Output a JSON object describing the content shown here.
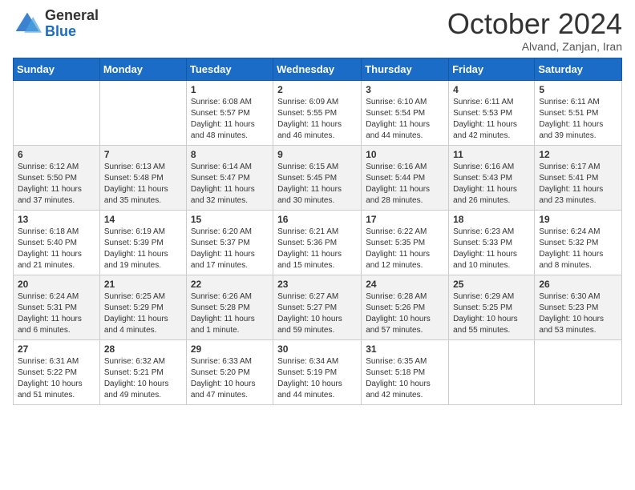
{
  "logo": {
    "general": "General",
    "blue": "Blue"
  },
  "header": {
    "month": "October 2024",
    "location": "Alvand, Zanjan, Iran"
  },
  "days_of_week": [
    "Sunday",
    "Monday",
    "Tuesday",
    "Wednesday",
    "Thursday",
    "Friday",
    "Saturday"
  ],
  "weeks": [
    [
      {
        "day": "",
        "sunrise": "",
        "sunset": "",
        "daylight": ""
      },
      {
        "day": "",
        "sunrise": "",
        "sunset": "",
        "daylight": ""
      },
      {
        "day": "1",
        "sunrise": "Sunrise: 6:08 AM",
        "sunset": "Sunset: 5:57 PM",
        "daylight": "Daylight: 11 hours and 48 minutes."
      },
      {
        "day": "2",
        "sunrise": "Sunrise: 6:09 AM",
        "sunset": "Sunset: 5:55 PM",
        "daylight": "Daylight: 11 hours and 46 minutes."
      },
      {
        "day": "3",
        "sunrise": "Sunrise: 6:10 AM",
        "sunset": "Sunset: 5:54 PM",
        "daylight": "Daylight: 11 hours and 44 minutes."
      },
      {
        "day": "4",
        "sunrise": "Sunrise: 6:11 AM",
        "sunset": "Sunset: 5:53 PM",
        "daylight": "Daylight: 11 hours and 42 minutes."
      },
      {
        "day": "5",
        "sunrise": "Sunrise: 6:11 AM",
        "sunset": "Sunset: 5:51 PM",
        "daylight": "Daylight: 11 hours and 39 minutes."
      }
    ],
    [
      {
        "day": "6",
        "sunrise": "Sunrise: 6:12 AM",
        "sunset": "Sunset: 5:50 PM",
        "daylight": "Daylight: 11 hours and 37 minutes."
      },
      {
        "day": "7",
        "sunrise": "Sunrise: 6:13 AM",
        "sunset": "Sunset: 5:48 PM",
        "daylight": "Daylight: 11 hours and 35 minutes."
      },
      {
        "day": "8",
        "sunrise": "Sunrise: 6:14 AM",
        "sunset": "Sunset: 5:47 PM",
        "daylight": "Daylight: 11 hours and 32 minutes."
      },
      {
        "day": "9",
        "sunrise": "Sunrise: 6:15 AM",
        "sunset": "Sunset: 5:45 PM",
        "daylight": "Daylight: 11 hours and 30 minutes."
      },
      {
        "day": "10",
        "sunrise": "Sunrise: 6:16 AM",
        "sunset": "Sunset: 5:44 PM",
        "daylight": "Daylight: 11 hours and 28 minutes."
      },
      {
        "day": "11",
        "sunrise": "Sunrise: 6:16 AM",
        "sunset": "Sunset: 5:43 PM",
        "daylight": "Daylight: 11 hours and 26 minutes."
      },
      {
        "day": "12",
        "sunrise": "Sunrise: 6:17 AM",
        "sunset": "Sunset: 5:41 PM",
        "daylight": "Daylight: 11 hours and 23 minutes."
      }
    ],
    [
      {
        "day": "13",
        "sunrise": "Sunrise: 6:18 AM",
        "sunset": "Sunset: 5:40 PM",
        "daylight": "Daylight: 11 hours and 21 minutes."
      },
      {
        "day": "14",
        "sunrise": "Sunrise: 6:19 AM",
        "sunset": "Sunset: 5:39 PM",
        "daylight": "Daylight: 11 hours and 19 minutes."
      },
      {
        "day": "15",
        "sunrise": "Sunrise: 6:20 AM",
        "sunset": "Sunset: 5:37 PM",
        "daylight": "Daylight: 11 hours and 17 minutes."
      },
      {
        "day": "16",
        "sunrise": "Sunrise: 6:21 AM",
        "sunset": "Sunset: 5:36 PM",
        "daylight": "Daylight: 11 hours and 15 minutes."
      },
      {
        "day": "17",
        "sunrise": "Sunrise: 6:22 AM",
        "sunset": "Sunset: 5:35 PM",
        "daylight": "Daylight: 11 hours and 12 minutes."
      },
      {
        "day": "18",
        "sunrise": "Sunrise: 6:23 AM",
        "sunset": "Sunset: 5:33 PM",
        "daylight": "Daylight: 11 hours and 10 minutes."
      },
      {
        "day": "19",
        "sunrise": "Sunrise: 6:24 AM",
        "sunset": "Sunset: 5:32 PM",
        "daylight": "Daylight: 11 hours and 8 minutes."
      }
    ],
    [
      {
        "day": "20",
        "sunrise": "Sunrise: 6:24 AM",
        "sunset": "Sunset: 5:31 PM",
        "daylight": "Daylight: 11 hours and 6 minutes."
      },
      {
        "day": "21",
        "sunrise": "Sunrise: 6:25 AM",
        "sunset": "Sunset: 5:29 PM",
        "daylight": "Daylight: 11 hours and 4 minutes."
      },
      {
        "day": "22",
        "sunrise": "Sunrise: 6:26 AM",
        "sunset": "Sunset: 5:28 PM",
        "daylight": "Daylight: 11 hours and 1 minute."
      },
      {
        "day": "23",
        "sunrise": "Sunrise: 6:27 AM",
        "sunset": "Sunset: 5:27 PM",
        "daylight": "Daylight: 10 hours and 59 minutes."
      },
      {
        "day": "24",
        "sunrise": "Sunrise: 6:28 AM",
        "sunset": "Sunset: 5:26 PM",
        "daylight": "Daylight: 10 hours and 57 minutes."
      },
      {
        "day": "25",
        "sunrise": "Sunrise: 6:29 AM",
        "sunset": "Sunset: 5:25 PM",
        "daylight": "Daylight: 10 hours and 55 minutes."
      },
      {
        "day": "26",
        "sunrise": "Sunrise: 6:30 AM",
        "sunset": "Sunset: 5:23 PM",
        "daylight": "Daylight: 10 hours and 53 minutes."
      }
    ],
    [
      {
        "day": "27",
        "sunrise": "Sunrise: 6:31 AM",
        "sunset": "Sunset: 5:22 PM",
        "daylight": "Daylight: 10 hours and 51 minutes."
      },
      {
        "day": "28",
        "sunrise": "Sunrise: 6:32 AM",
        "sunset": "Sunset: 5:21 PM",
        "daylight": "Daylight: 10 hours and 49 minutes."
      },
      {
        "day": "29",
        "sunrise": "Sunrise: 6:33 AM",
        "sunset": "Sunset: 5:20 PM",
        "daylight": "Daylight: 10 hours and 47 minutes."
      },
      {
        "day": "30",
        "sunrise": "Sunrise: 6:34 AM",
        "sunset": "Sunset: 5:19 PM",
        "daylight": "Daylight: 10 hours and 44 minutes."
      },
      {
        "day": "31",
        "sunrise": "Sunrise: 6:35 AM",
        "sunset": "Sunset: 5:18 PM",
        "daylight": "Daylight: 10 hours and 42 minutes."
      },
      {
        "day": "",
        "sunrise": "",
        "sunset": "",
        "daylight": ""
      },
      {
        "day": "",
        "sunrise": "",
        "sunset": "",
        "daylight": ""
      }
    ]
  ]
}
